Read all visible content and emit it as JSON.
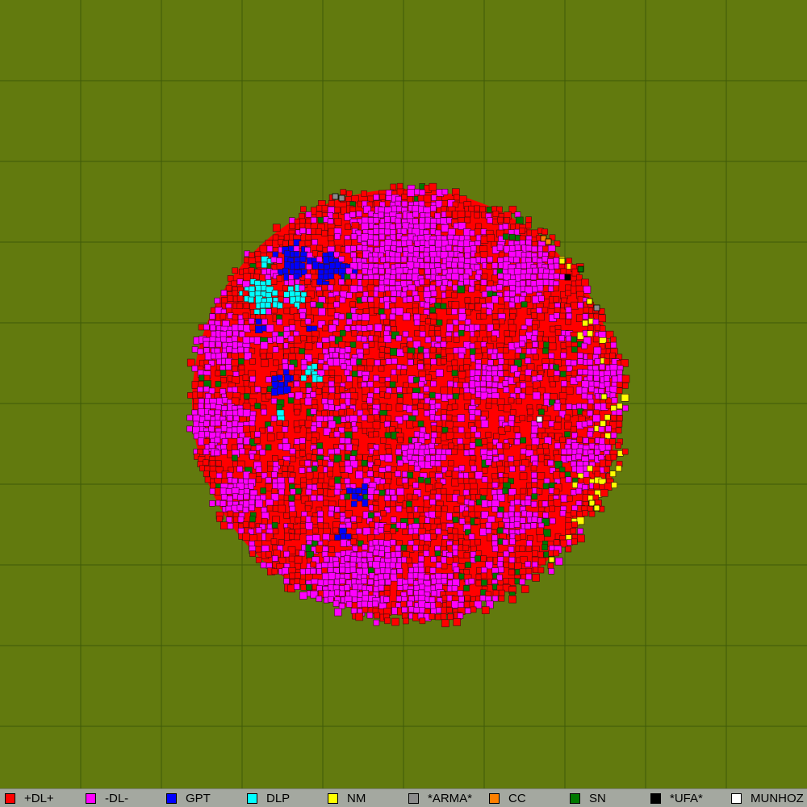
{
  "map": {
    "background_color": "#627a0e",
    "grid_color": "#3f5a08",
    "grid_divisions": 10,
    "planet_base_color": "#ff0000",
    "tile_border_color": "#3a1010"
  },
  "legend": {
    "items": [
      {
        "label": "+DL+",
        "color": "#ff0000"
      },
      {
        "label": "-DL-",
        "color": "#ff00ff"
      },
      {
        "label": "GPT",
        "color": "#0000ff"
      },
      {
        "label": "DLP",
        "color": "#00ffff"
      },
      {
        "label": "NM",
        "color": "#ffff00"
      },
      {
        "label": "*ARMA*",
        "color": "#8c8c8c"
      },
      {
        "label": "CC",
        "color": "#ff8000"
      },
      {
        "label": "SN",
        "color": "#007800"
      },
      {
        "label": "*UFA*",
        "color": "#000000"
      },
      {
        "label": "MUNHOZ",
        "color": "#ffffff"
      }
    ]
  }
}
